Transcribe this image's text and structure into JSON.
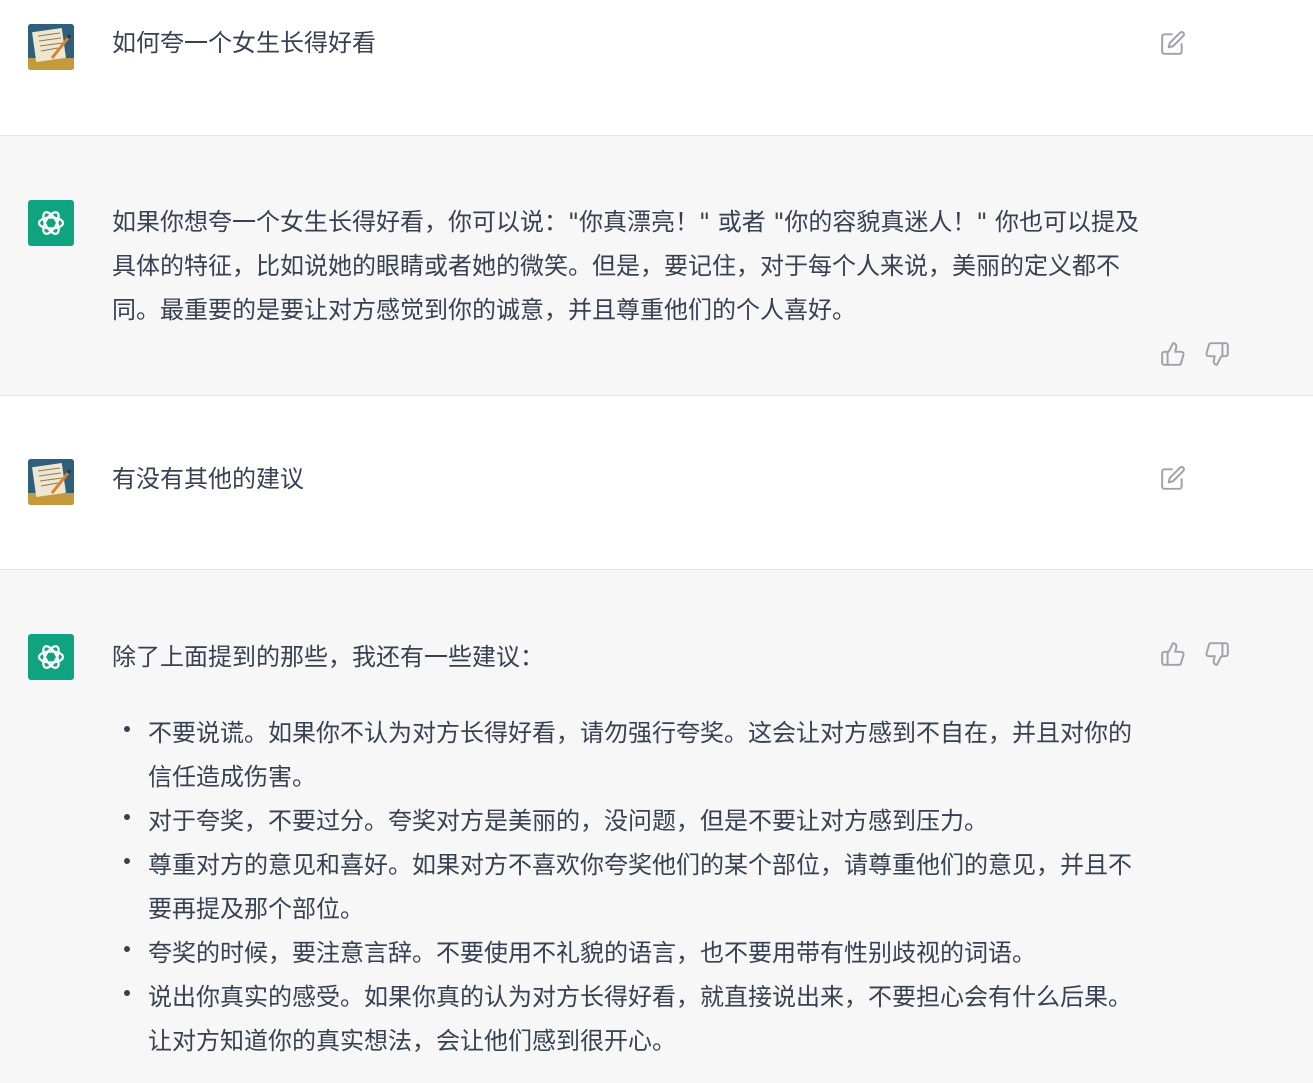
{
  "conversation": [
    {
      "role": "user",
      "text": "如何夸一个女生长得好看",
      "edit_icon": "edit-icon"
    },
    {
      "role": "assistant",
      "text": "如果你想夸一个女生长得好看，你可以说：\"你真漂亮！\" 或者 \"你的容貌真迷人！\" 你也可以提及具体的特征，比如说她的眼睛或者她的微笑。但是，要记住，对于每个人来说，美丽的定义都不同。最重要的是要让对方感觉到你的诚意，并且尊重他们的个人喜好。",
      "thumbs_up_icon": "thumbs-up-icon",
      "thumbs_down_icon": "thumbs-down-icon"
    },
    {
      "role": "user",
      "text": "有没有其他的建议",
      "edit_icon": "edit-icon"
    },
    {
      "role": "assistant",
      "intro": "除了上面提到的那些，我还有一些建议：",
      "bullets": [
        "不要说谎。如果你不认为对方长得好看，请勿强行夸奖。这会让对方感到不自在，并且对你的信任造成伤害。",
        "对于夸奖，不要过分。夸奖对方是美丽的，没问题，但是不要让对方感到压力。",
        "尊重对方的意见和喜好。如果对方不喜欢你夸奖他们的某个部位，请尊重他们的意见，并且不要再提及那个部位。",
        "夸奖的时候，要注意言辞。不要使用不礼貌的语言，也不要用带有性别歧视的词语。",
        "说出你真实的感受。如果你真的认为对方长得好看，就直接说出来，不要担心会有什么后果。让对方知道你的真实想法，会让他们感到很开心。"
      ],
      "thumbs_up_icon": "thumbs-up-icon",
      "thumbs_down_icon": "thumbs-down-icon"
    }
  ],
  "colors": {
    "assistant_bg": "#f7f7f8",
    "user_bg": "#ffffff",
    "bot_avatar": "#10a37f",
    "text": "#374151",
    "icon": "#a1a1aa"
  }
}
